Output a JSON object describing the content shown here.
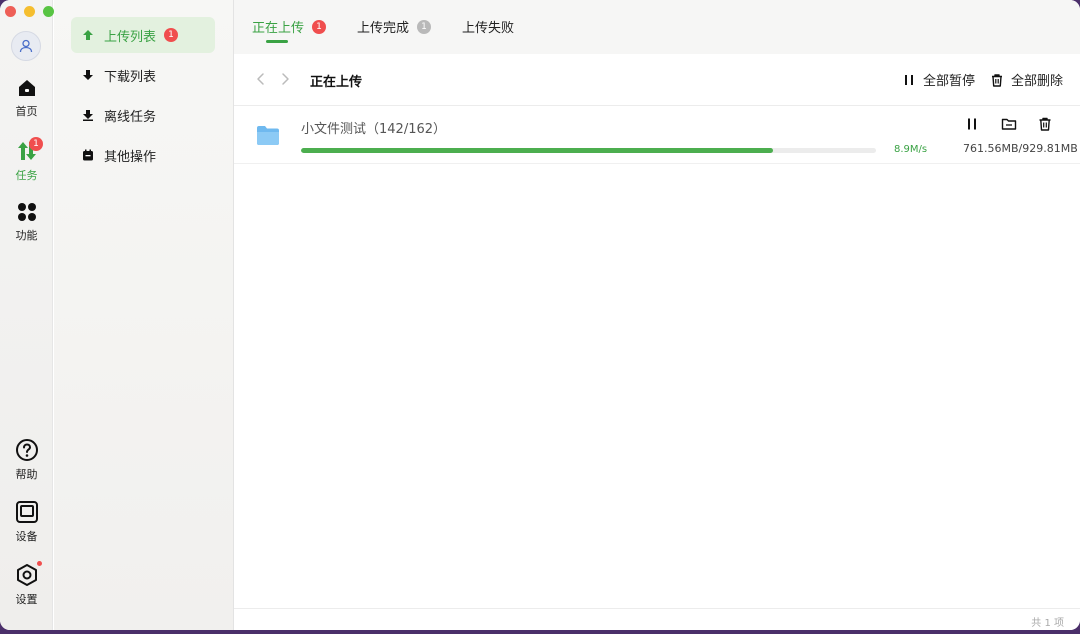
{
  "rail": {
    "items": [
      {
        "label": "首页",
        "icon": "home-icon"
      },
      {
        "label": "任务",
        "icon": "transfer-icon",
        "badge": "1"
      },
      {
        "label": "功能",
        "icon": "apps-icon"
      },
      {
        "label": "帮助",
        "icon": "help-icon"
      },
      {
        "label": "设备",
        "icon": "device-icon"
      },
      {
        "label": "设置",
        "icon": "settings-icon"
      }
    ],
    "accent": "#3aa244"
  },
  "subnav": {
    "items": [
      {
        "label": "上传列表",
        "badge": "1",
        "icon": "upload-arrow-icon"
      },
      {
        "label": "下载列表",
        "icon": "download-arrow-icon"
      },
      {
        "label": "离线任务",
        "icon": "offline-icon"
      },
      {
        "label": "其他操作",
        "icon": "calendar-icon"
      }
    ]
  },
  "tabs": [
    {
      "label": "正在上传",
      "badge": "1",
      "badge_color": "#f04e4e"
    },
    {
      "label": "上传完成",
      "badge": "1",
      "badge_color": "#b9b9b9"
    },
    {
      "label": "上传失败"
    }
  ],
  "toolbar": {
    "title": "正在上传",
    "pause_all": "全部暂停",
    "delete_all": "全部删除"
  },
  "task": {
    "name": "小文件测试（142/162）",
    "progress": 0.82,
    "speed": "8.9M/s",
    "size": "761.56MB/929.81MB"
  },
  "footer": {
    "count": "共 1 项"
  }
}
